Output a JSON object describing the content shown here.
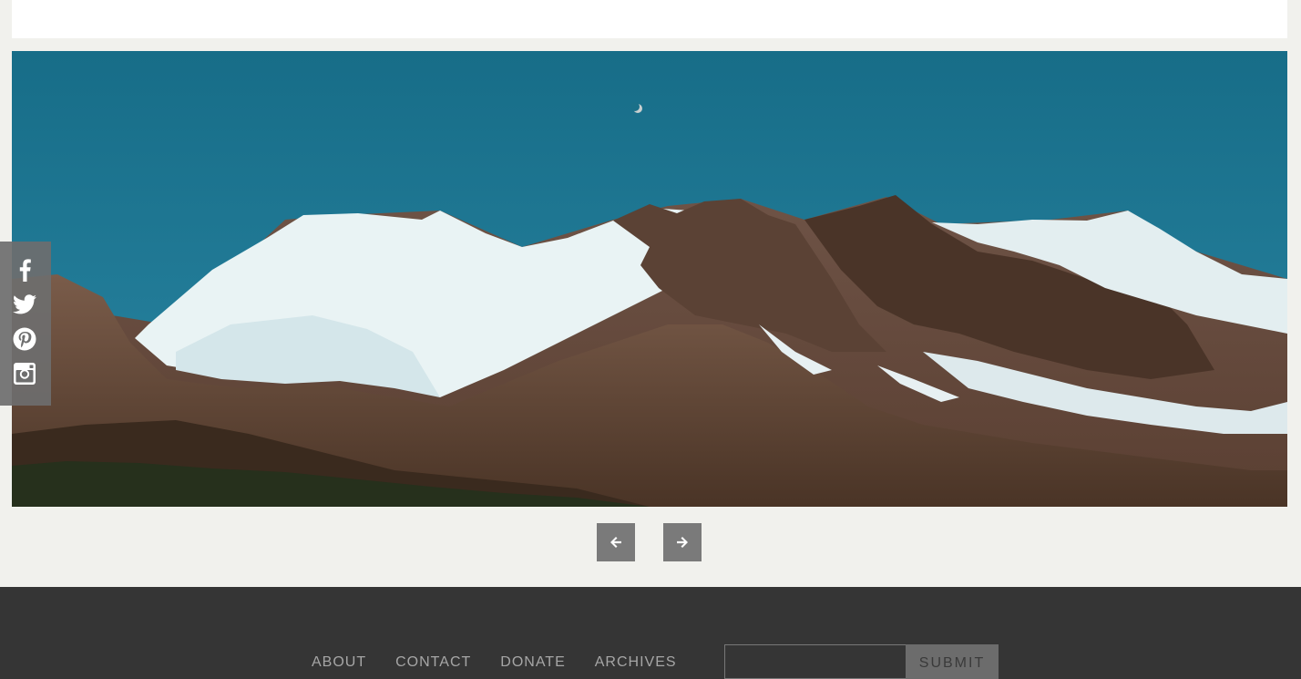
{
  "hero": {
    "alt": "Snow-capped mountain range under a clear blue sky with the moon"
  },
  "social": {
    "items": [
      {
        "name": "facebook",
        "icon": "facebook-icon"
      },
      {
        "name": "twitter",
        "icon": "twitter-icon"
      },
      {
        "name": "pinterest",
        "icon": "pinterest-icon"
      },
      {
        "name": "instagram",
        "icon": "instagram-icon"
      }
    ]
  },
  "slider": {
    "prev_icon": "arrow-left-icon",
    "next_icon": "arrow-right-icon"
  },
  "footer": {
    "nav": [
      {
        "label": "ABOUT"
      },
      {
        "label": "CONTACT"
      },
      {
        "label": "DONATE"
      },
      {
        "label": "ARCHIVES"
      }
    ],
    "newsletter": {
      "value": "",
      "placeholder": "",
      "submit_label": "SUBMIT"
    }
  },
  "colors": {
    "page_background": "#f1f1ed",
    "footer_background": "#353535",
    "control_gray": "#7a7a7a",
    "sky": "#1b7490"
  }
}
